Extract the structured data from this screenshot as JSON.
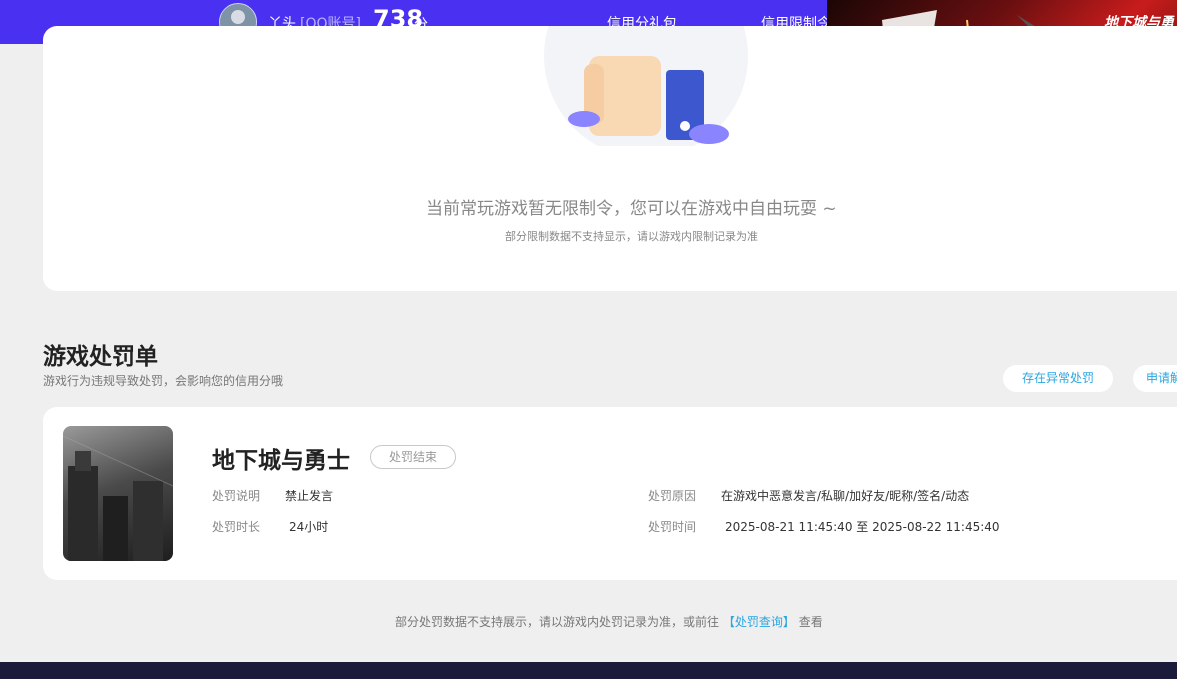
{
  "header": {
    "username": "丫头",
    "account_type": "[QQ账号]",
    "score": "738",
    "score_unit": "分",
    "nav": [
      "信用分礼包",
      "信用限制令"
    ]
  },
  "ad": {
    "logo_text": "地下城与勇士"
  },
  "restriction": {
    "empty_message": "当前常玩游戏暂无限制令，您可以在游戏中自由玩耍 ~",
    "empty_note": "部分限制数据不支持显示，请以游戏内限制记录为准"
  },
  "penalty": {
    "title": "游戏处罚单",
    "subtitle": "游戏行为违规导致处罚，会影响您的信用分哦",
    "buttons": [
      "存在异常处罚",
      "申请解"
    ],
    "item": {
      "game_name": "地下城与勇士",
      "status": "处罚结束",
      "desc_label": "处罚说明",
      "desc_value": "禁止发言",
      "duration_label": "处罚时长",
      "duration_value": "24小时",
      "reason_label": "处罚原因",
      "reason_value": "在游戏中恶意发言/私聊/加好友/昵称/签名/动态",
      "time_label": "处罚时间",
      "time_value": "2025-08-21 11:45:40 至 2025-08-22 11:45:40"
    }
  },
  "footer": {
    "note_prefix": "部分处罚数据不支持展示，请以游戏内处罚记录为准，或前往",
    "link_text": "【处罚查询】",
    "note_suffix": "查看"
  }
}
